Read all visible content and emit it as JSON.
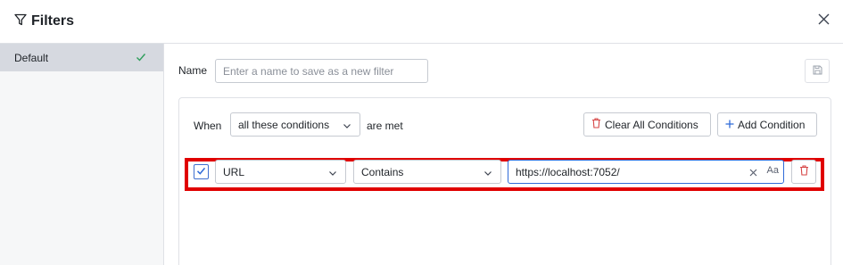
{
  "header": {
    "title": "Filters"
  },
  "sidebar": {
    "items": [
      {
        "label": "Default",
        "selected": true
      }
    ]
  },
  "form": {
    "name_label": "Name",
    "name_placeholder": "Enter a name to save as a new filter",
    "name_value": ""
  },
  "conditions": {
    "when_label": "When",
    "match_mode": "all these conditions",
    "met_label": "are met",
    "clear_all_label": "Clear All Conditions",
    "add_label": "Add Condition",
    "rows": [
      {
        "enabled": true,
        "field": "URL",
        "operator": "Contains",
        "value": "https://localhost:7052/",
        "case_label": "Aa"
      }
    ]
  },
  "colors": {
    "accent": "#2f6bd8",
    "highlight": "#e00000",
    "danger": "#d64545",
    "success": "#2e9e5b"
  }
}
